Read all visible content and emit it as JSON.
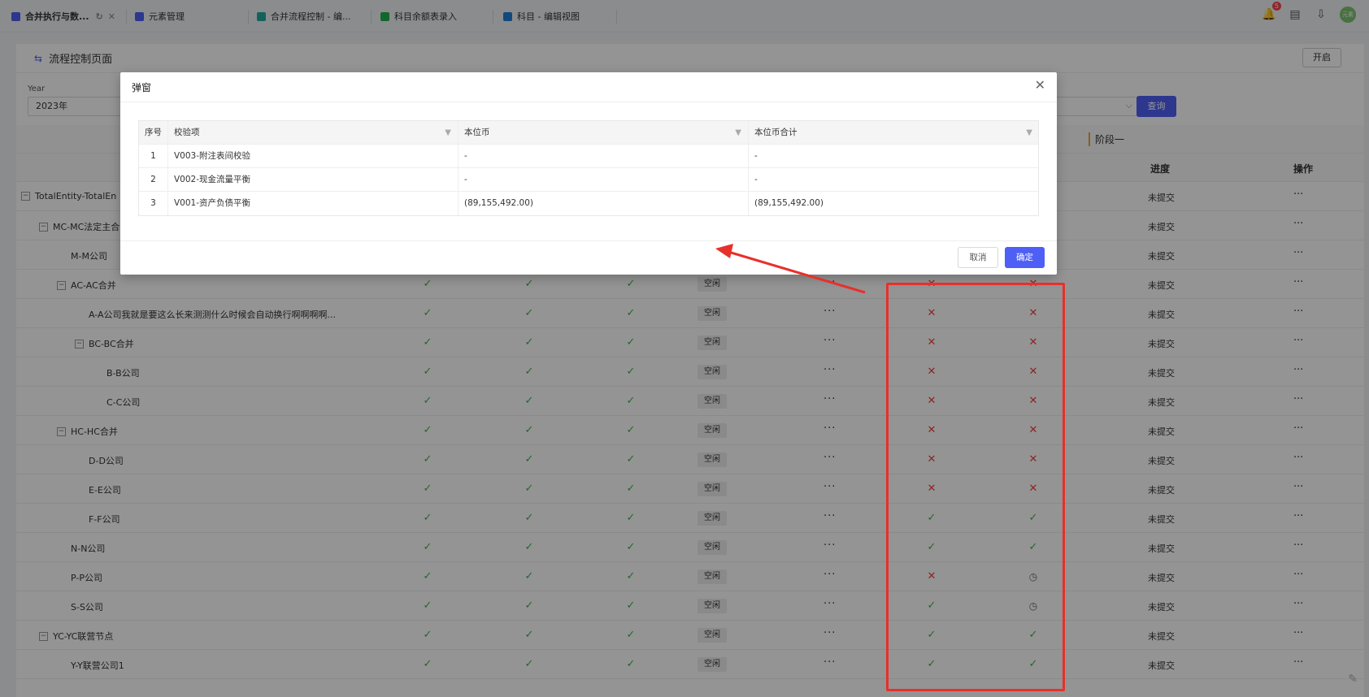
{
  "tabs": [
    {
      "label": "合并执行与数...",
      "active": true,
      "color": "#4e5ff5"
    },
    {
      "label": "元素管理",
      "color": "#4e5ff5"
    },
    {
      "label": "合并流程控制 - 编...",
      "color": "#22a7a0"
    },
    {
      "label": "科目余额表录入",
      "color": "#22b24c"
    },
    {
      "label": "科目 - 编辑视图",
      "color": "#1e7fd6"
    }
  ],
  "topbar": {
    "notification_count": "5",
    "avatar_text": "元素"
  },
  "page": {
    "title": "流程控制页面",
    "open_button": "开启",
    "year_label": "Year",
    "year_value": "2023年",
    "query_button": "查询",
    "stage_label": "阶段一",
    "progress_header": "进度",
    "ops_header": "操作"
  },
  "rows": [
    {
      "name": "TotalEntity-TotalEn",
      "indent": 0,
      "collapse": true,
      "cols": null,
      "status": null,
      "progress": "未提交"
    },
    {
      "name": "MC-MC法定主合",
      "indent": 1,
      "collapse": true,
      "cols": null,
      "status": null,
      "progress": "未提交"
    },
    {
      "name": "M-M公司",
      "indent": 2,
      "collapse": false,
      "cols": null,
      "status": null,
      "progress": "未提交"
    },
    {
      "name": "AC-AC合并",
      "indent": 2,
      "collapse": true,
      "cols": [
        "ok",
        "ok",
        "ok"
      ],
      "status": [
        "bad",
        "bad"
      ],
      "progress": "未提交"
    },
    {
      "name": "A-A公司我就是要这么长来测测什么时候会自动换行啊啊啊啊...",
      "indent": 3,
      "collapse": false,
      "cols": [
        "ok",
        "ok",
        "ok"
      ],
      "status": [
        "bad",
        "bad"
      ],
      "progress": "未提交"
    },
    {
      "name": "BC-BC合并",
      "indent": 3,
      "collapse": true,
      "cols": [
        "ok",
        "ok",
        "ok"
      ],
      "status": [
        "bad",
        "bad"
      ],
      "progress": "未提交"
    },
    {
      "name": "B-B公司",
      "indent": 4,
      "collapse": false,
      "cols": [
        "ok",
        "ok",
        "ok"
      ],
      "status": [
        "bad",
        "bad"
      ],
      "progress": "未提交"
    },
    {
      "name": "C-C公司",
      "indent": 4,
      "collapse": false,
      "cols": [
        "ok",
        "ok",
        "ok"
      ],
      "status": [
        "bad",
        "bad"
      ],
      "progress": "未提交"
    },
    {
      "name": "HC-HC合并",
      "indent": 2,
      "collapse": true,
      "cols": [
        "ok",
        "ok",
        "ok"
      ],
      "status": [
        "bad",
        "bad"
      ],
      "progress": "未提交"
    },
    {
      "name": "D-D公司",
      "indent": 3,
      "collapse": false,
      "cols": [
        "ok",
        "ok",
        "ok"
      ],
      "status": [
        "bad",
        "bad"
      ],
      "progress": "未提交"
    },
    {
      "name": "E-E公司",
      "indent": 3,
      "collapse": false,
      "cols": [
        "ok",
        "ok",
        "ok"
      ],
      "status": [
        "bad",
        "bad"
      ],
      "progress": "未提交"
    },
    {
      "name": "F-F公司",
      "indent": 3,
      "collapse": false,
      "cols": [
        "ok",
        "ok",
        "ok"
      ],
      "status": [
        "ok",
        "ok"
      ],
      "progress": "未提交"
    },
    {
      "name": "N-N公司",
      "indent": 2,
      "collapse": false,
      "cols": [
        "ok",
        "ok",
        "ok"
      ],
      "status": [
        "ok",
        "ok"
      ],
      "progress": "未提交"
    },
    {
      "name": "P-P公司",
      "indent": 2,
      "collapse": false,
      "cols": [
        "ok",
        "ok",
        "ok"
      ],
      "status": [
        "bad",
        "clock"
      ],
      "progress": "未提交"
    },
    {
      "name": "S-S公司",
      "indent": 2,
      "collapse": false,
      "cols": [
        "ok",
        "ok",
        "ok"
      ],
      "status": [
        "ok",
        "clock"
      ],
      "progress": "未提交"
    },
    {
      "name": "YC-YC联营节点",
      "indent": 1,
      "collapse": true,
      "cols": [
        "ok",
        "ok",
        "ok"
      ],
      "status": [
        "ok",
        "ok"
      ],
      "progress": "未提交"
    },
    {
      "name": "Y-Y联营公司1",
      "indent": 2,
      "collapse": false,
      "cols": [
        "ok",
        "ok",
        "ok"
      ],
      "status": [
        "ok",
        "ok"
      ],
      "progress": "未提交"
    }
  ],
  "idle_label": "空闲",
  "dialog": {
    "title": "弹窗",
    "headers": [
      "序号",
      "校验项",
      "本位币",
      "本位币合计"
    ],
    "rows": [
      [
        "1",
        "V003-附注表间校验",
        "-",
        "-"
      ],
      [
        "2",
        "V002-现金流量平衡",
        "-",
        "-"
      ],
      [
        "3",
        "V001-资产负债平衡",
        "(89,155,492.00)",
        "(89,155,492.00)"
      ]
    ],
    "cancel": "取消",
    "confirm": "确定"
  },
  "colors": {
    "accent": "#4e5ff5",
    "ok": "#3cb34a",
    "error": "#f23d3d",
    "annotation": "#e8302b"
  }
}
